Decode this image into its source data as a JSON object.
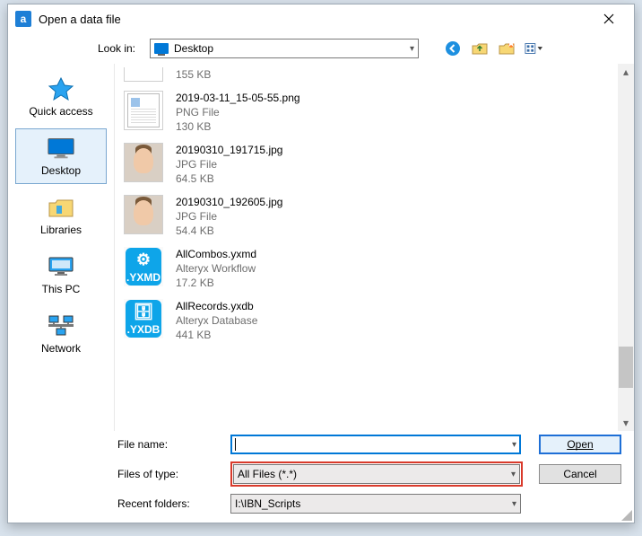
{
  "dialog": {
    "title": "Open a data file",
    "app_initial": "a"
  },
  "lookin": {
    "label": "Look in:",
    "value": "Desktop"
  },
  "toolbar": {
    "back": "back-icon",
    "up": "up-one-level-icon",
    "newfolder": "new-folder-icon",
    "view": "view-menu-icon"
  },
  "places": [
    {
      "id": "quick-access",
      "label": "Quick access",
      "selected": false
    },
    {
      "id": "desktop",
      "label": "Desktop",
      "selected": true
    },
    {
      "id": "libraries",
      "label": "Libraries",
      "selected": false
    },
    {
      "id": "this-pc",
      "label": "This PC",
      "selected": false
    },
    {
      "id": "network",
      "label": "Network",
      "selected": false
    }
  ],
  "files": [
    {
      "name": "",
      "type": "",
      "size": "155 KB",
      "thumb": "doc_partial"
    },
    {
      "name": "2019-03-11_15-05-55.png",
      "type": "PNG File",
      "size": "130 KB",
      "thumb": "doc"
    },
    {
      "name": "20190310_191715.jpg",
      "type": "JPG File",
      "size": "64.5 KB",
      "thumb": "photo"
    },
    {
      "name": "20190310_192605.jpg",
      "type": "JPG File",
      "size": "54.4 KB",
      "thumb": "photo"
    },
    {
      "name": "AllCombos.yxmd",
      "type": "Alteryx Workflow",
      "size": "17.2 KB",
      "thumb": "yxmd",
      "badge": ".YXMD"
    },
    {
      "name": "AllRecords.yxdb",
      "type": "Alteryx Database",
      "size": "441 KB",
      "thumb": "yxdb",
      "badge": ".YXDB"
    }
  ],
  "bottom": {
    "filename_label": "File name:",
    "filename_value": "",
    "filetype_label": "Files of type:",
    "filetype_value": "All Files (*.*)",
    "recent_label": "Recent folders:",
    "recent_value": "I:\\IBN_Scripts",
    "open_label": "Open",
    "cancel_label": "Cancel"
  }
}
